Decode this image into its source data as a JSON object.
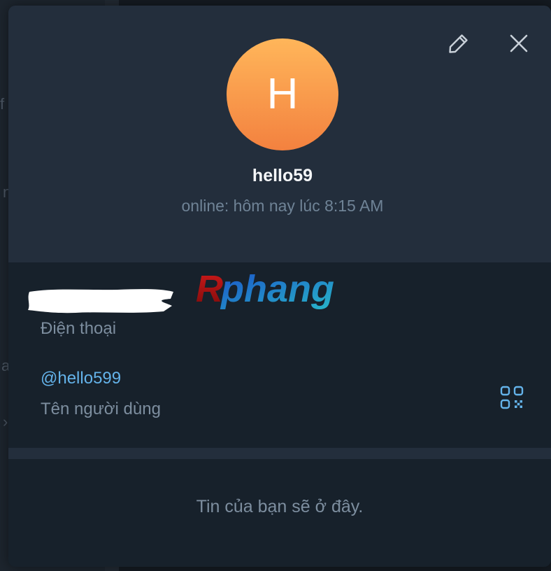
{
  "profile": {
    "avatar_letter": "H",
    "name": "hello59",
    "status": "online: hôm nay lúc 8:15 AM",
    "avatar_colors": {
      "top": "#ffb65a",
      "bottom": "#f3813f"
    }
  },
  "header_actions": {
    "edit_icon": "pencil-icon",
    "close_icon": "close-icon"
  },
  "info": {
    "phone_label": "Điện thoại",
    "username_value": "@hello599",
    "username_label": "Tên người dùng",
    "qr_icon": "qr-code-icon"
  },
  "watermark": {
    "text": "Rphang"
  },
  "stories": {
    "empty_text": "Tin của bạn sẽ ở đây."
  },
  "background": {
    "glyphs": [
      "f",
      "n",
      "a",
      "›"
    ]
  },
  "colors": {
    "modal_bg": "#17212b",
    "header_bg": "#232e3c",
    "accent": "#64b3ea",
    "muted_text": "#7d8e9f"
  }
}
